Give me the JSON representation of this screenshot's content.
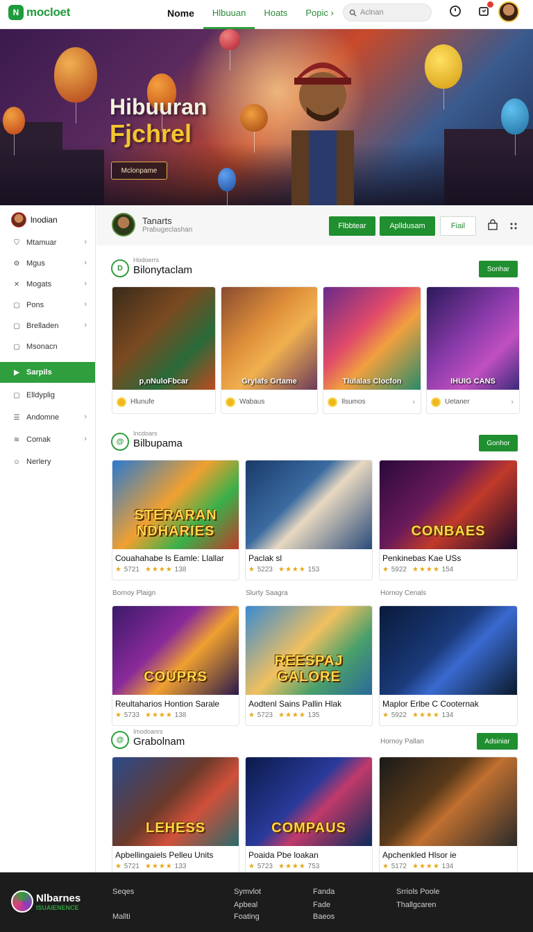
{
  "nav": {
    "brand": "mocloet",
    "links": [
      "Nome",
      "Hlbuuan",
      "Hoats",
      "Popic ›"
    ],
    "search_placeholder": "Aclnan"
  },
  "hero": {
    "title_line1": "Hibuuran",
    "title_line2": "Fjchrel",
    "button": "Mclonpame"
  },
  "sidebar": {
    "user": "lnodian",
    "items": [
      {
        "label": "Mtamuar",
        "icon": "shield-icon",
        "chevron": true
      },
      {
        "label": "Mgus",
        "icon": "gear-icon",
        "chevron": true
      },
      {
        "label": "Mogats",
        "icon": "cross-icon",
        "chevron": true
      },
      {
        "label": "Pons",
        "icon": "doc-icon",
        "chevron": true
      },
      {
        "label": "Brelladen",
        "icon": "doc-icon",
        "chevron": true
      },
      {
        "label": "Msonacn",
        "icon": "doc-icon",
        "chevron": false
      },
      {
        "label": "Sarpils",
        "icon": "play-icon",
        "chevron": false,
        "active": true
      },
      {
        "label": "Elldyplig",
        "icon": "doc-icon",
        "chevron": false
      },
      {
        "label": "Andomne",
        "icon": "list-icon",
        "chevron": true
      },
      {
        "label": "Comak",
        "icon": "wifi-icon",
        "chevron": true
      },
      {
        "label": "Nerlery",
        "icon": "user-icon",
        "chevron": false
      }
    ]
  },
  "mainbar": {
    "title": "Tanarts",
    "subtitle": "Prabugeclashan",
    "btn1": "Flbbtear",
    "btn2": "Aplldusam",
    "btn3": "Fiail"
  },
  "section1": {
    "kicker": "Hodoerrs",
    "title": "Bilonytaclam",
    "button": "Sonhar",
    "cards": [
      {
        "caption": "p,nNuloFbcar",
        "footer": "Hlunufe"
      },
      {
        "caption": "Grylafs Grtame",
        "footer": "Wabaus"
      },
      {
        "caption": "Tlulalas Clocfon",
        "footer": "Ilsumos"
      },
      {
        "caption": "IHUIG CANS",
        "footer": "Uetaner"
      }
    ]
  },
  "section2": {
    "kicker": "Incdoars",
    "title": "Bilbupama",
    "button": "Gonhor",
    "cards": [
      {
        "caption": "STERARAN\nNDHARIES",
        "title": "Couahahabe ls Eamle: Llallar",
        "rating": "5721",
        "score": "138"
      },
      {
        "caption": "",
        "title": "Paclak sl",
        "rating": "5223",
        "score": "153"
      },
      {
        "caption": "CONBAES",
        "title": "Penkinebas Kae USs",
        "rating": "5922",
        "score": "154"
      }
    ],
    "row_labels": [
      "Bornoy Plaign",
      "Slurty Saagra",
      "Hornoy Cenals"
    ],
    "cards2": [
      {
        "caption": "COUPRS",
        "title": "Reultaharios Hontion Sarale",
        "rating": "5733",
        "score": "138"
      },
      {
        "caption": "REESPAJ GALORE",
        "title": "Aodtenl Sains Pallin Hlak",
        "rating": "5723",
        "score": "135"
      },
      {
        "caption": "",
        "title": "Maplor Erlbe C Cooternak",
        "rating": "5922",
        "score": "134"
      }
    ]
  },
  "section3": {
    "kicker": "Imodoanrs",
    "title": "Grabolnam",
    "side_label": "Hornoy Pallan",
    "button": "Adsiniar",
    "cards": [
      {
        "caption": "LEHESS",
        "title": "Apbellingaiels Pelleu Units",
        "rating": "5721",
        "score": "133"
      },
      {
        "caption": "COMPAUS",
        "title": "Poaida Pbe loakan",
        "rating": "5723",
        "score": "753"
      },
      {
        "caption": "",
        "title": "Apchenkled Hlsor ie",
        "rating": "5172",
        "score": "134"
      }
    ]
  },
  "footer": {
    "brand": "Nlbarnes",
    "brand_sub": "ISUAIENENCE",
    "col1": [
      "Seqes",
      "Mallti"
    ],
    "col2": [
      "Symvlot",
      "Apbeal",
      "Foating"
    ],
    "col3": [
      "Fanda",
      "Fade",
      "Baeos"
    ],
    "col4": [
      "Srriols Poole",
      "Thallgcaren"
    ]
  },
  "colors": {
    "accent": "#2f9e3d",
    "footer_bg": "#1c1c1c",
    "star": "#e5a91a"
  }
}
